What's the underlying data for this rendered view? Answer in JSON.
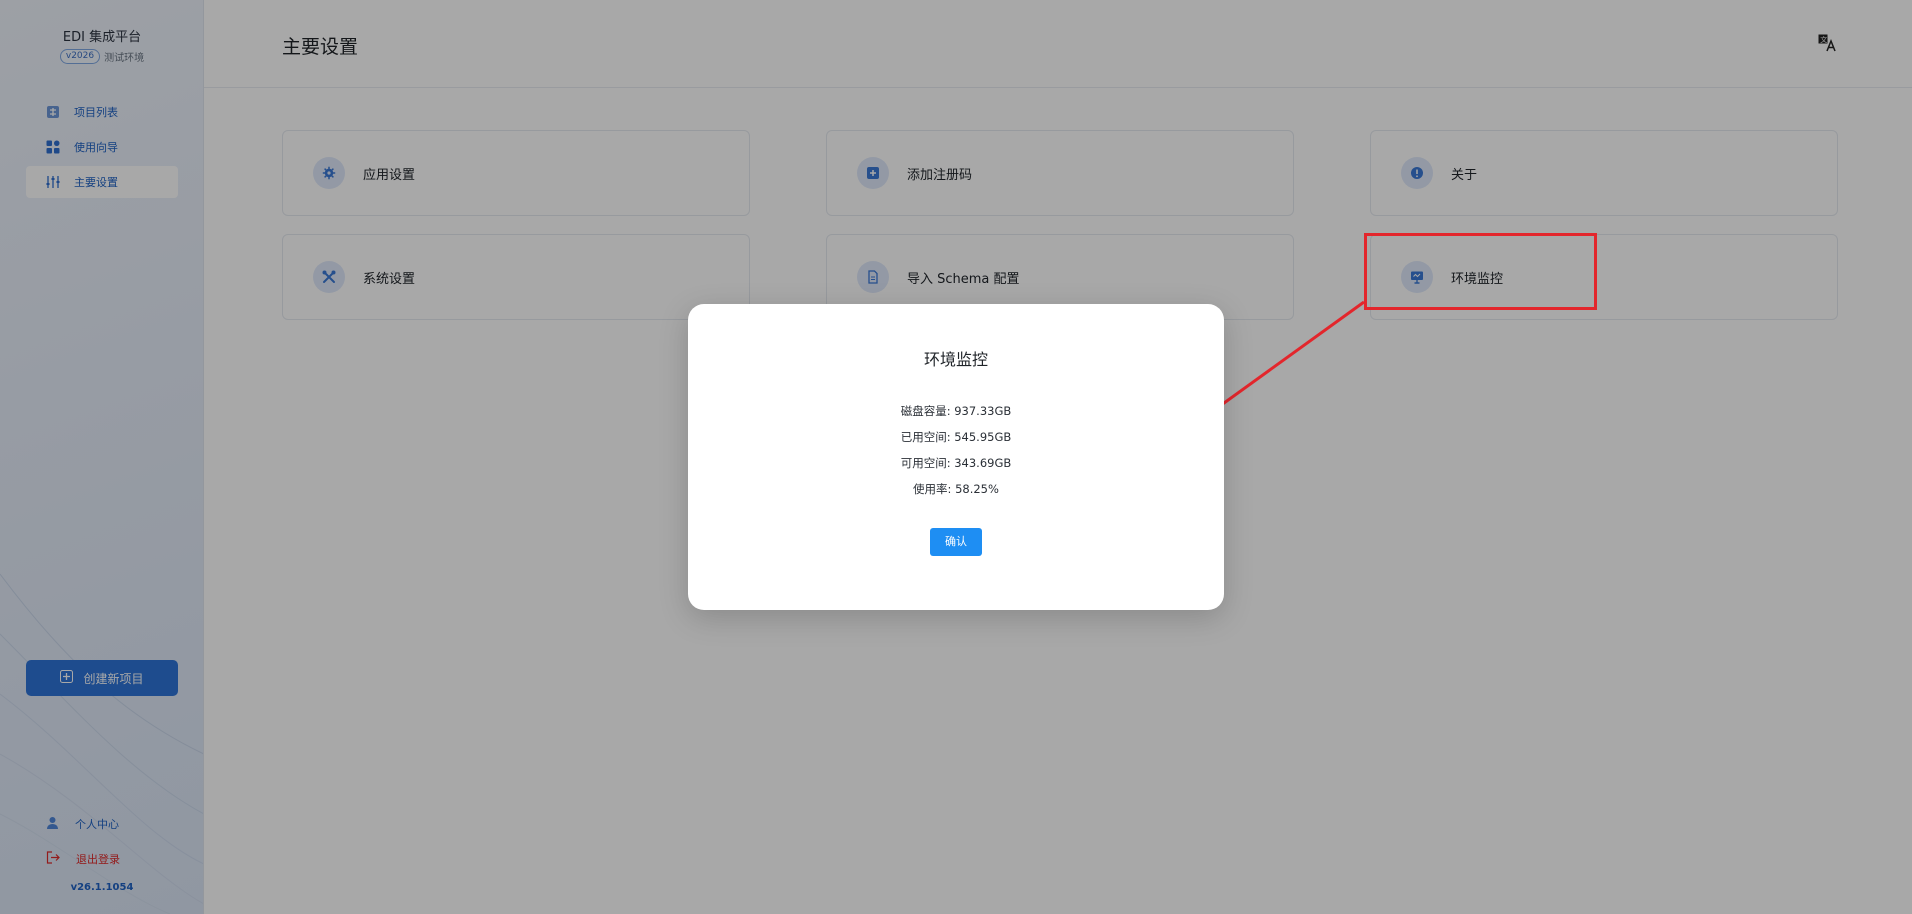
{
  "brand": {
    "title": "EDI 集成平台",
    "version_pill": "v2026",
    "env_label": "测试环境"
  },
  "sidebar": {
    "items": [
      {
        "label": "项目列表",
        "icon": "project-list-icon",
        "active": false
      },
      {
        "label": "使用向导",
        "icon": "guide-grid-icon",
        "active": false
      },
      {
        "label": "主要设置",
        "icon": "settings-sliders-icon",
        "active": true
      }
    ],
    "create_button": "创建新项目",
    "profile": "个人中心",
    "logout": "退出登录",
    "app_version": "v26.1.1054"
  },
  "header": {
    "title": "主要设置"
  },
  "cards": [
    {
      "label": "应用设置",
      "icon": "gear-icon"
    },
    {
      "label": "添加注册码",
      "icon": "plus-square-icon"
    },
    {
      "label": "关于",
      "icon": "info-icon"
    },
    {
      "label": "系统设置",
      "icon": "tools-icon"
    },
    {
      "label": "导入 Schema 配置",
      "icon": "document-icon"
    },
    {
      "label": "环境监控",
      "icon": "monitor-icon"
    }
  ],
  "modal": {
    "title": "环境监控",
    "lines": [
      "磁盘容量: 937.33GB",
      "已用空间: 545.95GB",
      "可用空间: 343.69GB",
      "使用率: 58.25%"
    ],
    "confirm": "确认"
  },
  "colors": {
    "accent": "#2e74d8",
    "link": "#1f62c4",
    "danger": "#e02a2a",
    "annotation": "#e3262c",
    "confirm": "#1e8ef3"
  }
}
